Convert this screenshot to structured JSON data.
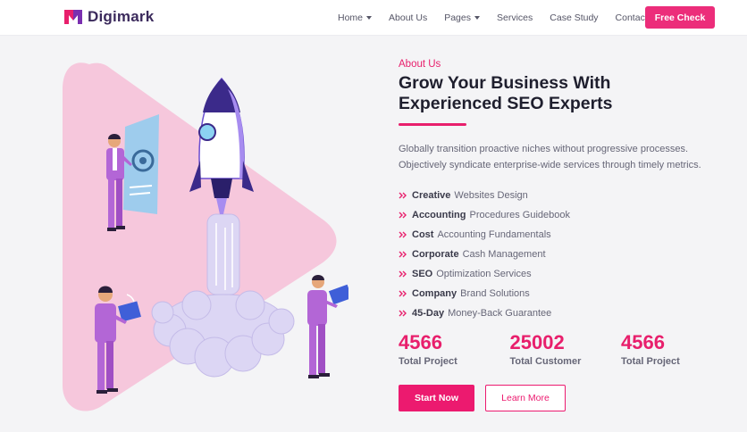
{
  "header": {
    "logo_text": "Digimark",
    "nav": [
      {
        "label": "Home",
        "has_dropdown": true
      },
      {
        "label": "About Us",
        "has_dropdown": false
      },
      {
        "label": "Pages",
        "has_dropdown": true
      },
      {
        "label": "Services",
        "has_dropdown": false
      },
      {
        "label": "Case Study",
        "has_dropdown": false
      },
      {
        "label": "Contact Us",
        "has_dropdown": false
      }
    ],
    "cta_label": "Free Check"
  },
  "about": {
    "eyebrow": "About Us",
    "title_line1": "Grow Your Business With",
    "title_line2": "Experienced SEO Experts",
    "desc_line1": "Globally transition proactive niches without progressive processes.",
    "desc_line2": "Objectively syndicate enterprise-wide services through timely metrics.",
    "features": [
      {
        "bold": "Creative",
        "text": "Websites Design"
      },
      {
        "bold": "Accounting",
        "text": "Procedures Guidebook"
      },
      {
        "bold": "Cost",
        "text": "Accounting Fundamentals"
      },
      {
        "bold": "Corporate",
        "text": "Cash Management"
      },
      {
        "bold": "SEO",
        "text": "Optimization Services"
      },
      {
        "bold": "Company",
        "text": "Brand Solutions"
      },
      {
        "bold": "45-Day",
        "text": "Money-Back Guarantee"
      }
    ],
    "stats": [
      {
        "number": "4566",
        "label": "Total Project"
      },
      {
        "number": "25002",
        "label": "Total Customer"
      },
      {
        "number": "4566",
        "label": "Total Project"
      }
    ],
    "primary_button": "Start Now",
    "secondary_button": "Learn More"
  },
  "colors": {
    "accent": "#ec1a6f",
    "brand_dark": "#3b2a5c",
    "triangle": "#f6c7dc",
    "rocket": "#a78cf0"
  },
  "icons": {
    "logo": "digimark-logo-icon",
    "feature_bullet": "double-chevron-right-icon",
    "dropdown": "caret-down-icon"
  }
}
